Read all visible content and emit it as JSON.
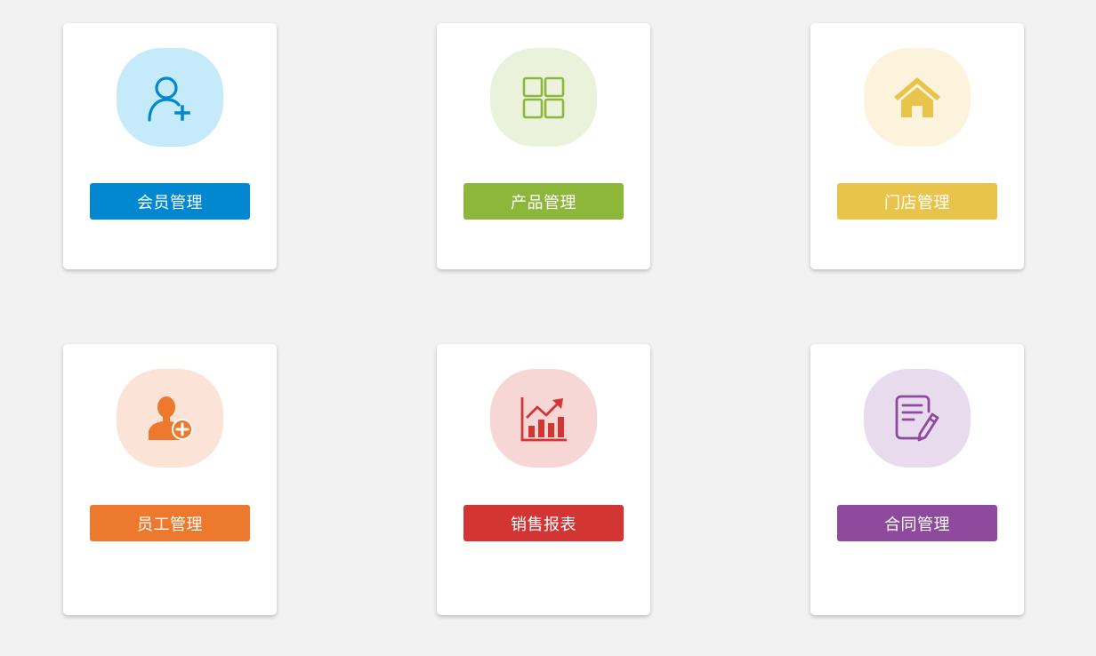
{
  "cards": [
    {
      "label": "会员管理",
      "icon": "add-user-outline-icon",
      "color": "#0288d1",
      "bg": "#c5ebfb"
    },
    {
      "label": "产品管理",
      "icon": "grid-icon",
      "color": "#8db73b",
      "bg": "#eaf2db"
    },
    {
      "label": "门店管理",
      "icon": "home-icon",
      "color": "#e9c44a",
      "bg": "#fbf3dc"
    },
    {
      "label": "员工管理",
      "icon": "add-employee-icon",
      "color": "#ec792d",
      "bg": "#fce3d8"
    },
    {
      "label": "销售报表",
      "icon": "bar-chart-trend-icon",
      "color": "#d33535",
      "bg": "#f7d6d6"
    },
    {
      "label": "合同管理",
      "icon": "contract-edit-icon",
      "color": "#8e4b9d",
      "bg": "#e8dbee"
    }
  ]
}
